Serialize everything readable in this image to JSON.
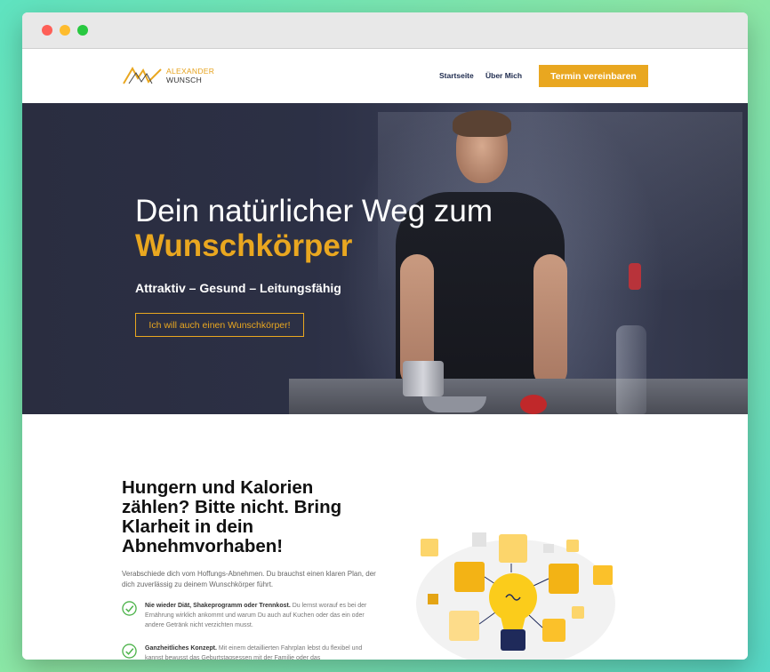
{
  "browser": {
    "buttons": [
      "close",
      "minimize",
      "maximize"
    ]
  },
  "header": {
    "logo": {
      "line1": "ALEXANDER",
      "line2": "WUNSCH"
    },
    "nav": {
      "home": "Startseite",
      "about": "Über Mich"
    },
    "cta": "Termin vereinbaren"
  },
  "hero": {
    "title_line1": "Dein natürlicher Weg zum",
    "title_line2": "Wunschkörper",
    "subtitle": "Attraktiv – Gesund – Leitungsfähig",
    "button": "Ich will auch einen Wunschkörper!"
  },
  "main": {
    "heading": "Hungern und Kalorien zählen? Bitte nicht. Bring Klarheit in dein Abnehmvorhaben!",
    "intro": "Verabschiede dich vom Hoffungs-Abnehmen. Du brauchst einen klaren Plan, der dich zuverlässig zu deinem Wunschkörper führt.",
    "features": [
      {
        "bold": "Nie wieder Diät, Shakeprogramm oder Trennkost.",
        "text": " Du lernst worauf es bei der Ernährung wirklich ankommt und warum Du auch auf Kuchen oder das ein oder andere Getränk nicht verzichten musst."
      },
      {
        "bold": "Ganzheitliches Konzept.",
        "text": " Mit einem detaillierten Fahrplan lebst du flexibel und kannst bewusst das Geburtstagsessen mit der Familie oder das"
      }
    ]
  },
  "colors": {
    "accent": "#e9a720",
    "nav_text": "#1d2a4d",
    "hero_bg": "#2c3045"
  },
  "icons": [
    "logo-mark-icon",
    "check-circle-icon",
    "lightbulb-icon"
  ]
}
